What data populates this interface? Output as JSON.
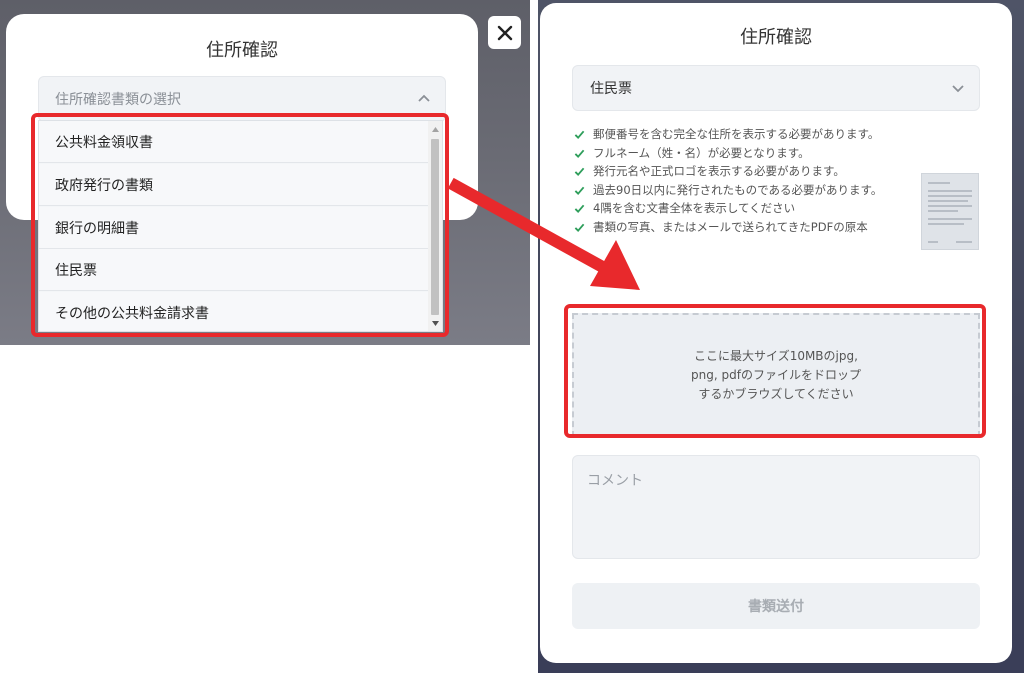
{
  "left_panel": {
    "modal_title": "住所確認",
    "select_placeholder": "住所確認書類の選択",
    "dropdown_options": [
      "公共料金領収書",
      "政府発行の書類",
      "銀行の明細書",
      "住民票",
      "その他の公共料金請求書"
    ],
    "close_icon": "close-icon"
  },
  "right_panel": {
    "modal_title": "住所確認",
    "selected_document": "住民票",
    "requirements": [
      "郵便番号を含む完全な住所を表示する必要があります。",
      "フルネーム（姓・名）が必要となります。",
      "発行元名や正式ロゴを表示する必要があります。",
      "過去90日以内に発行されたものである必要があります。",
      "4隅を含む文書全体を表示してください",
      "書類の写真、またはメールで送られてきたPDFの原本"
    ],
    "dropzone_text": "ここに最大サイズ10MBのjpg, png, pdfのファイルをドロップするかブラウズしてください",
    "comment_placeholder": "コメント",
    "submit_label": "書類送付"
  },
  "colors": {
    "highlight_red": "#e8292c",
    "check_green": "#2e9e5b",
    "overlay_left": "#6a6b74",
    "overlay_right": "#3f4359"
  }
}
